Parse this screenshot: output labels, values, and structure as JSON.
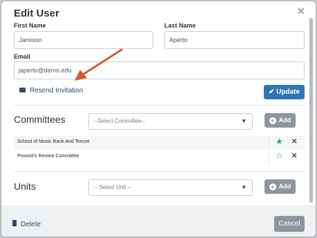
{
  "modal": {
    "title": "Edit User"
  },
  "fields": {
    "first_name": {
      "label": "First Name",
      "value": "Jamison"
    },
    "last_name": {
      "label": "Last Name",
      "value": "Aperto"
    },
    "email": {
      "label": "Email",
      "value": "japerto@demo.edu"
    }
  },
  "actions": {
    "resend": "Resend Invitation",
    "update": "Update",
    "delete": "Delete",
    "cancel": "Cancel"
  },
  "committees": {
    "title": "Committees",
    "select_placeholder": "--Select Committee--",
    "add_label": "Add",
    "items": [
      {
        "name": "School of Music Rank And Tenure",
        "starred": true
      },
      {
        "name": "Provost's Review Committee",
        "starred": false
      }
    ]
  },
  "units": {
    "title": "Units",
    "select_placeholder": "-- Select Unit --",
    "add_label": "Add"
  },
  "colors": {
    "accent": "#2f76b5",
    "annotation_arrow": "#d35a32",
    "star": "#1aa38c"
  }
}
